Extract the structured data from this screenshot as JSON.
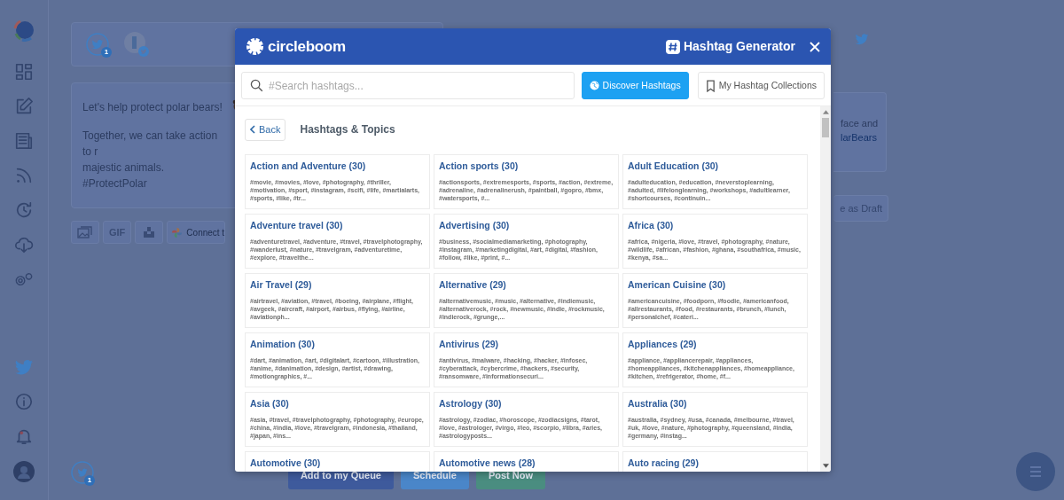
{
  "composer": {
    "accounts": [
      {
        "kind": "twitter",
        "badge": "1"
      },
      {
        "kind": "avatar"
      }
    ],
    "paragraphs": [
      "Let's help protect polar bears!",
      "Together, we can take action to r",
      "majestic animals. #ProtectPolar"
    ],
    "toolbar": {
      "gif": "GIF",
      "connect": "Connect t"
    },
    "footer_badge": "1",
    "actions": [
      "Add to my Queue",
      "Schedule",
      "Post Now"
    ]
  },
  "preview": {
    "lines": [
      "face and",
      "larBears"
    ],
    "draft": "e as Draft"
  },
  "modal": {
    "brand": "circleboom",
    "title": "Hashtag Generator",
    "search": {
      "placeholder": "#Search hashtags..."
    },
    "tabs": [
      {
        "label": "Discover Hashtags",
        "selected": true
      },
      {
        "label": "My Hashtag Collections",
        "selected": false
      }
    ],
    "back": "Back",
    "heading": "Hashtags & Topics",
    "topics": [
      {
        "title": "Action and Adventure (30)",
        "tags": "#movie, #movies, #love, #photography, #thriller, #motivation, #sport, #instagram, #scifi, #life, #martialarts, #sports, #like, #tr..."
      },
      {
        "title": "Action sports (30)",
        "tags": "#actionsports, #extremesports, #sports, #action, #extreme, #adrenaline, #adrenalinerush, #paintball, #gopro, #bmx, #watersports, #..."
      },
      {
        "title": "Adult Education (30)",
        "tags": "#adulteducation, #education, #neverstoplearning, #adulted, #lifelonglearning, #workshops, #adultlearner, #shortcourses, #continuin..."
      },
      {
        "title": "Adventure travel (30)",
        "tags": "#adventuretravel, #adventure, #travel, #travelphotography, #wanderlust, #nature, #travelgram, #adventuretime, #explore, #travelthe..."
      },
      {
        "title": "Advertising (30)",
        "tags": "#business, #socialmediamarketing, #photography, #instagram, #marketingdigital, #art, #digital, #fashion, #follow, #like, #print, #..."
      },
      {
        "title": "Africa (30)",
        "tags": "#africa, #nigeria, #love, #travel, #photography, #nature, #wildlife, #african, #fashion, #ghana, #southafrica, #music, #kenya, #sa..."
      },
      {
        "title": "Air Travel (29)",
        "tags": "#airtravel, #aviation, #travel, #boeing, #airplane, #flight, #avgeek, #aircraft, #airport, #airbus, #flying, #airline, #aviationph..."
      },
      {
        "title": "Alternative (29)",
        "tags": "#alternativemusic, #music, #alternative, #indiemusic, #alternativerock, #rock, #newmusic, #indie, #rockmusic, #indierock, #grunge,..."
      },
      {
        "title": "American Cuisine (30)",
        "tags": "#americancuisine, #foodporn, #foodie, #americanfood, #allrestaurants, #food, #restaurants, #brunch, #lunch, #personalchef, #cateri..."
      },
      {
        "title": "Animation (30)",
        "tags": "#dart, #animation, #art, #digitalart, #cartoon, #illustration, #anime, #danimation, #design, #artist, #drawing, #motiongraphics, #..."
      },
      {
        "title": "Antivirus (29)",
        "tags": "#antivirus, #malware, #hacking, #hacker, #infosec, #cyberattack, #cybercrime, #hackers, #security, #ransomware, #informationsecuri..."
      },
      {
        "title": "Appliances (29)",
        "tags": "#appliance, #appliancerepair, #appliances, #homeappliances, #kitchenappliances, #homeappliance, #kitchen, #refrigerator, #home, #f..."
      },
      {
        "title": "Asia (30)",
        "tags": "#asia, #travel, #travelphotography, #photography, #europe, #china, #india, #love, #travelgram, #indonesia, #thailand, #japan, #ins..."
      },
      {
        "title": "Astrology (30)",
        "tags": "#astrology, #zodiac, #horoscope, #zodiacsigns, #tarot, #love, #astrologer, #virgo, #leo, #scorpio, #libra, #aries, #astrologyposts..."
      },
      {
        "title": "Australia (30)",
        "tags": "#australia, #sydney, #usa, #canada, #melbourne, #travel, #uk, #love, #nature, #photography, #queensland, #india, #germany, #instag..."
      },
      {
        "title": "Automotive (30)"
      },
      {
        "title": "Automotive news (28)"
      },
      {
        "title": "Auto racing (29)"
      }
    ]
  }
}
